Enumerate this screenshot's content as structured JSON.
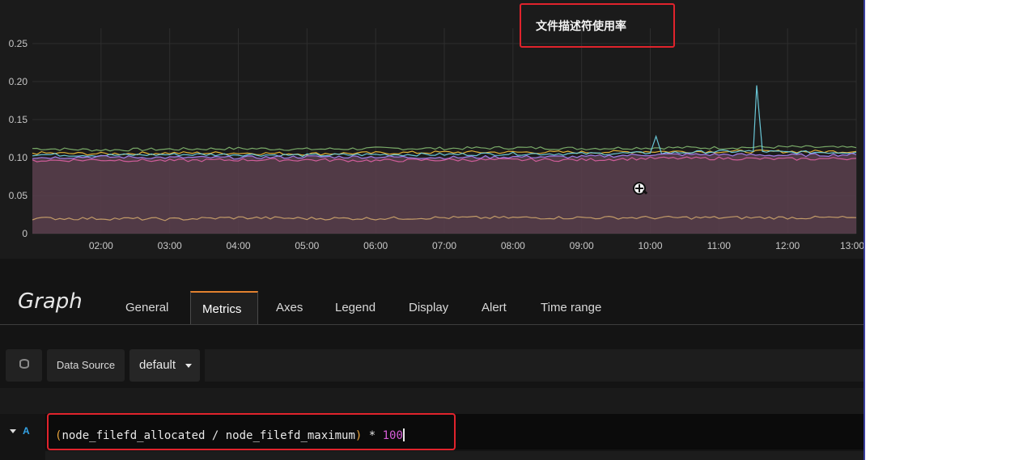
{
  "annotation": {
    "text": "文件描述符使用率"
  },
  "editor": {
    "title": "Graph",
    "tabs": [
      {
        "label": "General",
        "active": false
      },
      {
        "label": "Metrics",
        "active": true
      },
      {
        "label": "Axes",
        "active": false
      },
      {
        "label": "Legend",
        "active": false
      },
      {
        "label": "Display",
        "active": false
      },
      {
        "label": "Alert",
        "active": false
      },
      {
        "label": "Time range",
        "active": false
      }
    ]
  },
  "datasource": {
    "label": "Data Source",
    "value": "default"
  },
  "query": {
    "ref_id": "A",
    "expression": "(node_filefd_allocated / node_filefd_maximum) * 100",
    "tokens": {
      "open_paren": "(",
      "body": "node_filefd_allocated / node_filefd_maximum",
      "close_paren": ")",
      "op": " * ",
      "number": "100"
    }
  },
  "colors": {
    "accent": "#e2812f",
    "highlight": "#e0232c",
    "query_number": "#d45bd6",
    "query_paren": "#e8a23a",
    "ref_id": "#33a2e5"
  },
  "chart_data": {
    "type": "line",
    "title": "",
    "xlabel": "",
    "ylabel": "",
    "x_ticks": [
      "02:00",
      "03:00",
      "04:00",
      "05:00",
      "06:00",
      "07:00",
      "08:00",
      "09:00",
      "10:00",
      "11:00",
      "12:00",
      "13:00"
    ],
    "y_ticks": [
      "0",
      "0.05",
      "0.10",
      "0.15",
      "0.20",
      "0.25"
    ],
    "ylim": [
      0,
      0.27
    ],
    "xlim": [
      "01:00",
      "13:00"
    ],
    "grid": true,
    "legend": "none",
    "fill_series": "purple",
    "series": [
      {
        "color": "#7eb26d",
        "points": [
          [
            "01:00",
            0.112
          ],
          [
            "02:00",
            0.11
          ],
          [
            "03:00",
            0.111
          ],
          [
            "04:00",
            0.112
          ],
          [
            "05:00",
            0.111
          ],
          [
            "06:00",
            0.112
          ],
          [
            "07:00",
            0.112
          ],
          [
            "08:00",
            0.113
          ],
          [
            "09:00",
            0.112
          ],
          [
            "10:00",
            0.113
          ],
          [
            "11:00",
            0.113
          ],
          [
            "12:00",
            0.114
          ],
          [
            "13:00",
            0.113
          ]
        ]
      },
      {
        "color": "#eab839",
        "points": [
          [
            "01:00",
            0.106
          ],
          [
            "02:00",
            0.105
          ],
          [
            "03:00",
            0.106
          ],
          [
            "04:00",
            0.106
          ],
          [
            "05:00",
            0.105
          ],
          [
            "06:00",
            0.106
          ],
          [
            "07:00",
            0.107
          ],
          [
            "08:00",
            0.107
          ],
          [
            "09:00",
            0.107
          ],
          [
            "10:00",
            0.108
          ],
          [
            "11:00",
            0.108
          ],
          [
            "12:00",
            0.108
          ],
          [
            "13:00",
            0.108
          ]
        ]
      },
      {
        "color": "#6ed0e0",
        "points": [
          [
            "01:00",
            0.104
          ],
          [
            "02:00",
            0.103
          ],
          [
            "03:00",
            0.104
          ],
          [
            "04:00",
            0.104
          ],
          [
            "05:00",
            0.103
          ],
          [
            "06:00",
            0.104
          ],
          [
            "07:00",
            0.104
          ],
          [
            "08:00",
            0.105
          ],
          [
            "09:00",
            0.105
          ],
          [
            "10:00",
            0.106
          ],
          [
            "10:05",
            0.128
          ],
          [
            "10:10",
            0.106
          ],
          [
            "11:00",
            0.108
          ],
          [
            "11:30",
            0.108
          ],
          [
            "11:33",
            0.195
          ],
          [
            "11:38",
            0.108
          ],
          [
            "12:00",
            0.107
          ],
          [
            "13:00",
            0.107
          ]
        ]
      },
      {
        "color": "#a77ff0",
        "points": [
          [
            "01:00",
            0.1
          ],
          [
            "02:00",
            0.101
          ],
          [
            "03:00",
            0.1
          ],
          [
            "04:00",
            0.1
          ],
          [
            "05:00",
            0.101
          ],
          [
            "06:00",
            0.101
          ],
          [
            "07:00",
            0.1
          ],
          [
            "08:00",
            0.101
          ],
          [
            "09:00",
            0.101
          ],
          [
            "10:00",
            0.104
          ],
          [
            "11:00",
            0.104
          ],
          [
            "12:00",
            0.103
          ],
          [
            "13:00",
            0.104
          ]
        ]
      },
      {
        "color": "#d65f9e",
        "points": [
          [
            "01:00",
            0.096
          ],
          [
            "02:00",
            0.097
          ],
          [
            "03:00",
            0.096
          ],
          [
            "04:00",
            0.097
          ],
          [
            "05:00",
            0.097
          ],
          [
            "06:00",
            0.096
          ],
          [
            "07:00",
            0.097
          ],
          [
            "08:00",
            0.097
          ],
          [
            "09:00",
            0.097
          ],
          [
            "10:00",
            0.099
          ],
          [
            "11:00",
            0.099
          ],
          [
            "12:00",
            0.098
          ],
          [
            "13:00",
            0.099
          ]
        ]
      },
      {
        "color": "#c8a06a",
        "points": [
          [
            "01:00",
            0.02
          ],
          [
            "02:00",
            0.02
          ],
          [
            "03:00",
            0.019
          ],
          [
            "04:00",
            0.021
          ],
          [
            "05:00",
            0.02
          ],
          [
            "06:00",
            0.02
          ],
          [
            "07:00",
            0.021
          ],
          [
            "08:00",
            0.021
          ],
          [
            "09:00",
            0.021
          ],
          [
            "10:00",
            0.021
          ],
          [
            "11:00",
            0.021
          ],
          [
            "12:00",
            0.021
          ],
          [
            "13:00",
            0.021
          ]
        ]
      }
    ]
  }
}
